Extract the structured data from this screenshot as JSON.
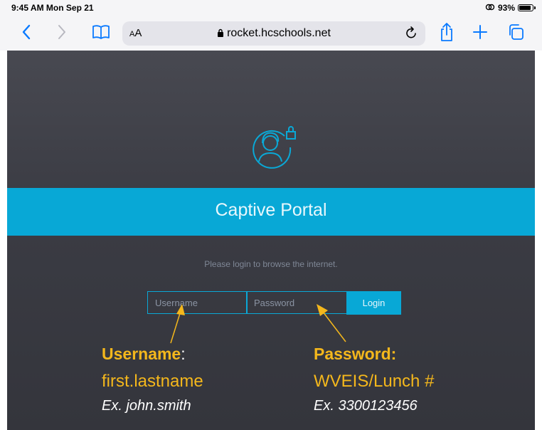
{
  "status": {
    "time": "9:45 AM  Mon Sep 21",
    "battery": "93%",
    "battery_level": 0.93
  },
  "browser": {
    "text_size_label": "AA",
    "url": "rocket.hcschools.net"
  },
  "portal": {
    "title": "Captive Portal",
    "prompt": "Please login to browse the internet.",
    "username_placeholder": "Username",
    "password_placeholder": "Password",
    "login_label": "Login"
  },
  "annotations": {
    "username": {
      "title": "Username",
      "colon": ":",
      "value": "first.lastname",
      "example": "Ex. john.smith"
    },
    "password": {
      "title": "Password:",
      "value": "WVEIS/Lunch #",
      "example": "Ex. 3300123456"
    }
  },
  "colors": {
    "accent": "#08a8d6",
    "annotation": "#f4b71c",
    "page_bg": "#3b3c44"
  }
}
